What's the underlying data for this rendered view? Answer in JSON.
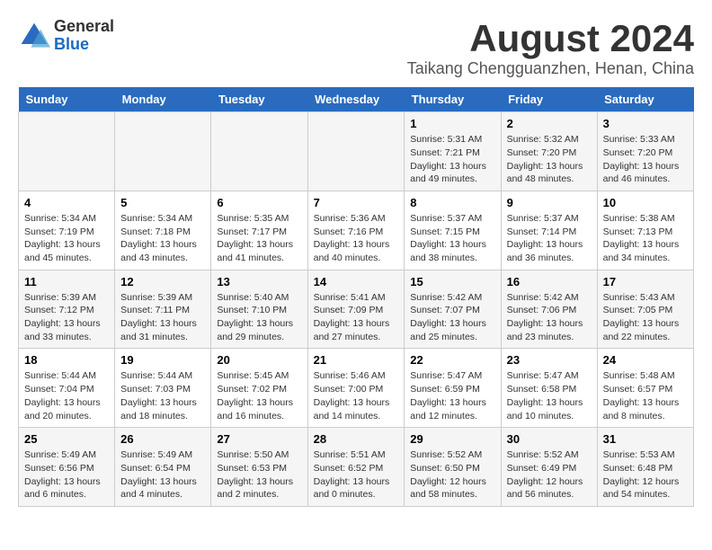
{
  "logo": {
    "general": "General",
    "blue": "Blue"
  },
  "title": "August 2024",
  "subtitle": "Taikang Chengguanzhen, Henan, China",
  "weekdays": [
    "Sunday",
    "Monday",
    "Tuesday",
    "Wednesday",
    "Thursday",
    "Friday",
    "Saturday"
  ],
  "weeks": [
    [
      {
        "num": "",
        "info": ""
      },
      {
        "num": "",
        "info": ""
      },
      {
        "num": "",
        "info": ""
      },
      {
        "num": "",
        "info": ""
      },
      {
        "num": "1",
        "info": "Sunrise: 5:31 AM\nSunset: 7:21 PM\nDaylight: 13 hours and 49 minutes."
      },
      {
        "num": "2",
        "info": "Sunrise: 5:32 AM\nSunset: 7:20 PM\nDaylight: 13 hours and 48 minutes."
      },
      {
        "num": "3",
        "info": "Sunrise: 5:33 AM\nSunset: 7:20 PM\nDaylight: 13 hours and 46 minutes."
      }
    ],
    [
      {
        "num": "4",
        "info": "Sunrise: 5:34 AM\nSunset: 7:19 PM\nDaylight: 13 hours and 45 minutes."
      },
      {
        "num": "5",
        "info": "Sunrise: 5:34 AM\nSunset: 7:18 PM\nDaylight: 13 hours and 43 minutes."
      },
      {
        "num": "6",
        "info": "Sunrise: 5:35 AM\nSunset: 7:17 PM\nDaylight: 13 hours and 41 minutes."
      },
      {
        "num": "7",
        "info": "Sunrise: 5:36 AM\nSunset: 7:16 PM\nDaylight: 13 hours and 40 minutes."
      },
      {
        "num": "8",
        "info": "Sunrise: 5:37 AM\nSunset: 7:15 PM\nDaylight: 13 hours and 38 minutes."
      },
      {
        "num": "9",
        "info": "Sunrise: 5:37 AM\nSunset: 7:14 PM\nDaylight: 13 hours and 36 minutes."
      },
      {
        "num": "10",
        "info": "Sunrise: 5:38 AM\nSunset: 7:13 PM\nDaylight: 13 hours and 34 minutes."
      }
    ],
    [
      {
        "num": "11",
        "info": "Sunrise: 5:39 AM\nSunset: 7:12 PM\nDaylight: 13 hours and 33 minutes."
      },
      {
        "num": "12",
        "info": "Sunrise: 5:39 AM\nSunset: 7:11 PM\nDaylight: 13 hours and 31 minutes."
      },
      {
        "num": "13",
        "info": "Sunrise: 5:40 AM\nSunset: 7:10 PM\nDaylight: 13 hours and 29 minutes."
      },
      {
        "num": "14",
        "info": "Sunrise: 5:41 AM\nSunset: 7:09 PM\nDaylight: 13 hours and 27 minutes."
      },
      {
        "num": "15",
        "info": "Sunrise: 5:42 AM\nSunset: 7:07 PM\nDaylight: 13 hours and 25 minutes."
      },
      {
        "num": "16",
        "info": "Sunrise: 5:42 AM\nSunset: 7:06 PM\nDaylight: 13 hours and 23 minutes."
      },
      {
        "num": "17",
        "info": "Sunrise: 5:43 AM\nSunset: 7:05 PM\nDaylight: 13 hours and 22 minutes."
      }
    ],
    [
      {
        "num": "18",
        "info": "Sunrise: 5:44 AM\nSunset: 7:04 PM\nDaylight: 13 hours and 20 minutes."
      },
      {
        "num": "19",
        "info": "Sunrise: 5:44 AM\nSunset: 7:03 PM\nDaylight: 13 hours and 18 minutes."
      },
      {
        "num": "20",
        "info": "Sunrise: 5:45 AM\nSunset: 7:02 PM\nDaylight: 13 hours and 16 minutes."
      },
      {
        "num": "21",
        "info": "Sunrise: 5:46 AM\nSunset: 7:00 PM\nDaylight: 13 hours and 14 minutes."
      },
      {
        "num": "22",
        "info": "Sunrise: 5:47 AM\nSunset: 6:59 PM\nDaylight: 13 hours and 12 minutes."
      },
      {
        "num": "23",
        "info": "Sunrise: 5:47 AM\nSunset: 6:58 PM\nDaylight: 13 hours and 10 minutes."
      },
      {
        "num": "24",
        "info": "Sunrise: 5:48 AM\nSunset: 6:57 PM\nDaylight: 13 hours and 8 minutes."
      }
    ],
    [
      {
        "num": "25",
        "info": "Sunrise: 5:49 AM\nSunset: 6:56 PM\nDaylight: 13 hours and 6 minutes."
      },
      {
        "num": "26",
        "info": "Sunrise: 5:49 AM\nSunset: 6:54 PM\nDaylight: 13 hours and 4 minutes."
      },
      {
        "num": "27",
        "info": "Sunrise: 5:50 AM\nSunset: 6:53 PM\nDaylight: 13 hours and 2 minutes."
      },
      {
        "num": "28",
        "info": "Sunrise: 5:51 AM\nSunset: 6:52 PM\nDaylight: 13 hours and 0 minutes."
      },
      {
        "num": "29",
        "info": "Sunrise: 5:52 AM\nSunset: 6:50 PM\nDaylight: 12 hours and 58 minutes."
      },
      {
        "num": "30",
        "info": "Sunrise: 5:52 AM\nSunset: 6:49 PM\nDaylight: 12 hours and 56 minutes."
      },
      {
        "num": "31",
        "info": "Sunrise: 5:53 AM\nSunset: 6:48 PM\nDaylight: 12 hours and 54 minutes."
      }
    ]
  ]
}
